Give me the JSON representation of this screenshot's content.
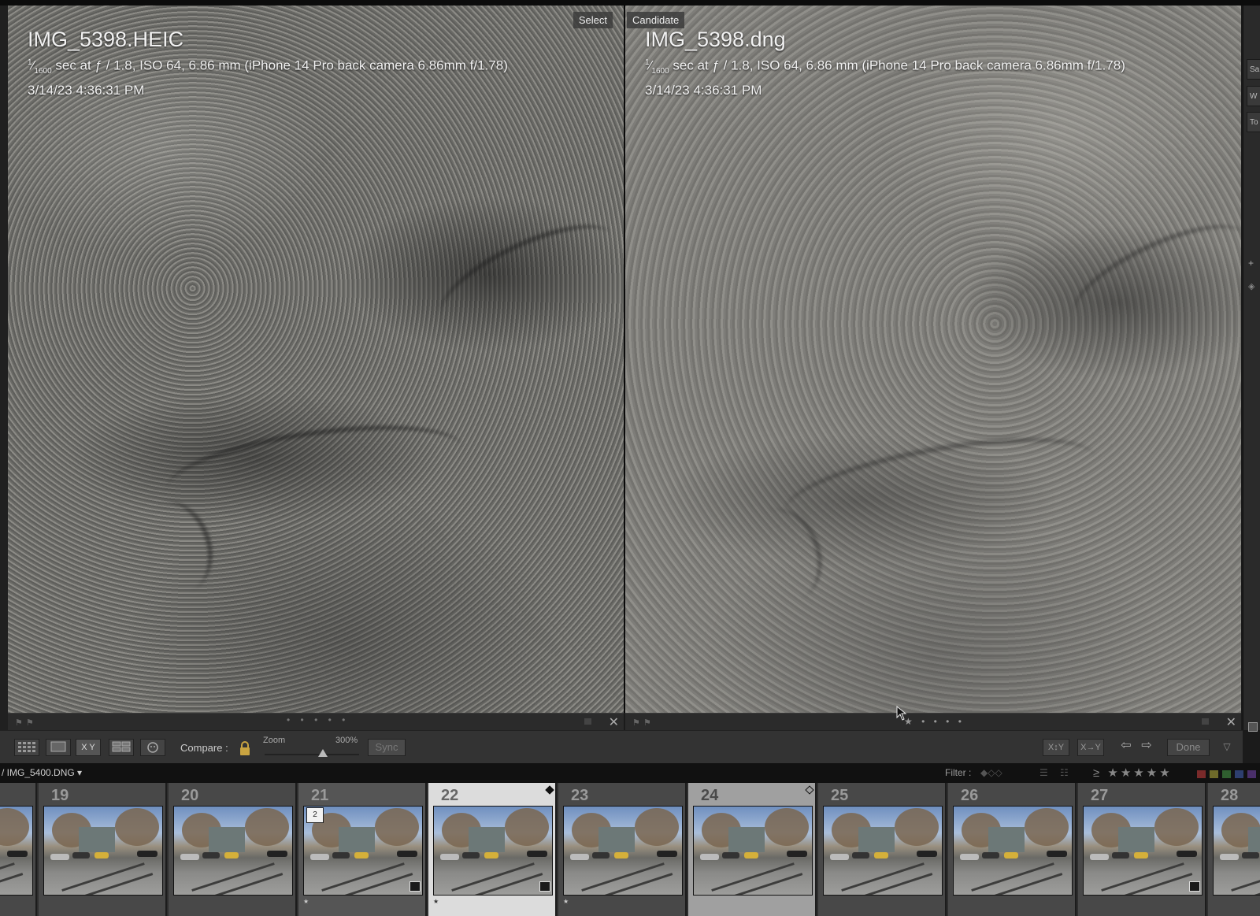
{
  "left_photo": {
    "label": "Select",
    "filename": "IMG_5398.HEIC",
    "exposure_sup": "1",
    "exposure_sub": "1600",
    "exposure_rest": " sec at ƒ / 1.8, ISO 64, 6.86 mm (iPhone 14 Pro back camera 6.86mm f/1.78)",
    "timestamp": "3/14/23 4:36:31 PM",
    "dots": "• • • • •"
  },
  "right_photo": {
    "label": "Candidate",
    "filename": "IMG_5398.dng",
    "exposure_sup": "1",
    "exposure_sub": "1600",
    "exposure_rest": " sec at ƒ / 1.8, ISO 64, 6.86 mm (iPhone 14 Pro back camera 6.86mm f/1.78)",
    "timestamp": "3/14/23 4:36:31 PM",
    "stars": "★ • • • •"
  },
  "right_panel_tabs": [
    "Sa",
    "W",
    "To"
  ],
  "toolbar": {
    "compare_label": "Compare :",
    "zoom_label": "Zoom",
    "zoom_value": "300%",
    "zoom_fraction": 0.62,
    "sync_label": "Sync",
    "swap_label": "X↕Y",
    "copy_label": "X→Y",
    "done_label": "Done",
    "view_buttons": [
      "grid-view",
      "loupe-view",
      "compare-view",
      "survey-view",
      "people-view"
    ],
    "xy_label": "X Y"
  },
  "filmstrip_header": {
    "path": "/ IMG_5400.DNG ▾",
    "filter_label": "Filter :",
    "rating_filter": "≥ ★★★★★",
    "color_filters": [
      "#7a2a2a",
      "#6e6a2a",
      "#2f5f2f",
      "#2e3f6f",
      "#4a2f6a"
    ]
  },
  "filmstrip": {
    "cells": [
      {
        "num": "",
        "state": "normal"
      },
      {
        "num": "19",
        "state": "normal"
      },
      {
        "num": "20",
        "state": "normal"
      },
      {
        "num": "21",
        "state": "selected"
      },
      {
        "num": "22",
        "state": "active"
      },
      {
        "num": "23",
        "state": "normal"
      },
      {
        "num": "24",
        "state": "candidate"
      },
      {
        "num": "25",
        "state": "normal"
      },
      {
        "num": "26",
        "state": "normal"
      },
      {
        "num": "27",
        "state": "normal"
      },
      {
        "num": "28",
        "state": "normal"
      }
    ],
    "stack_count": "2"
  }
}
